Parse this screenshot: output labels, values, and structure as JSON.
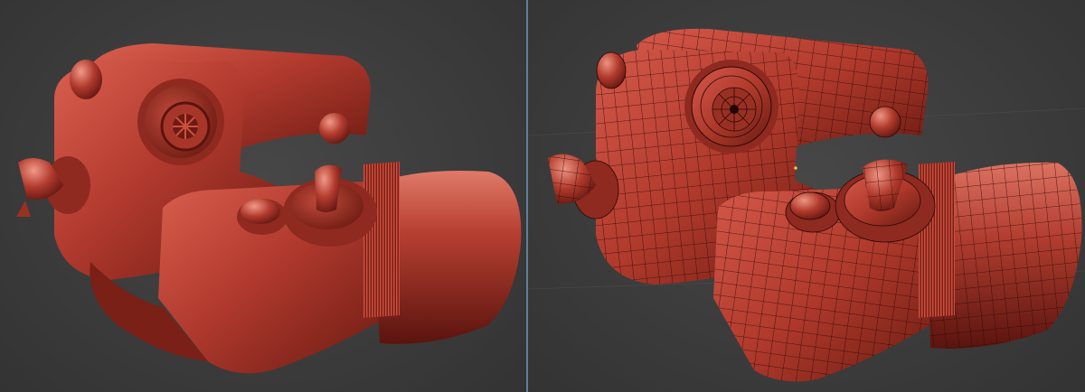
{
  "viewports": [
    {
      "id": "sculpt-view",
      "shading": "solid",
      "wireframe": false
    },
    {
      "id": "retopo-view",
      "shading": "solid",
      "wireframe": true
    }
  ],
  "colors": {
    "background": "#3a3a3a",
    "divider": "#5f7f9c",
    "model_base": "#b23a2e",
    "model_highlight": "#e07a68",
    "model_shadow": "#5a140e",
    "wire": "#2a0805"
  }
}
